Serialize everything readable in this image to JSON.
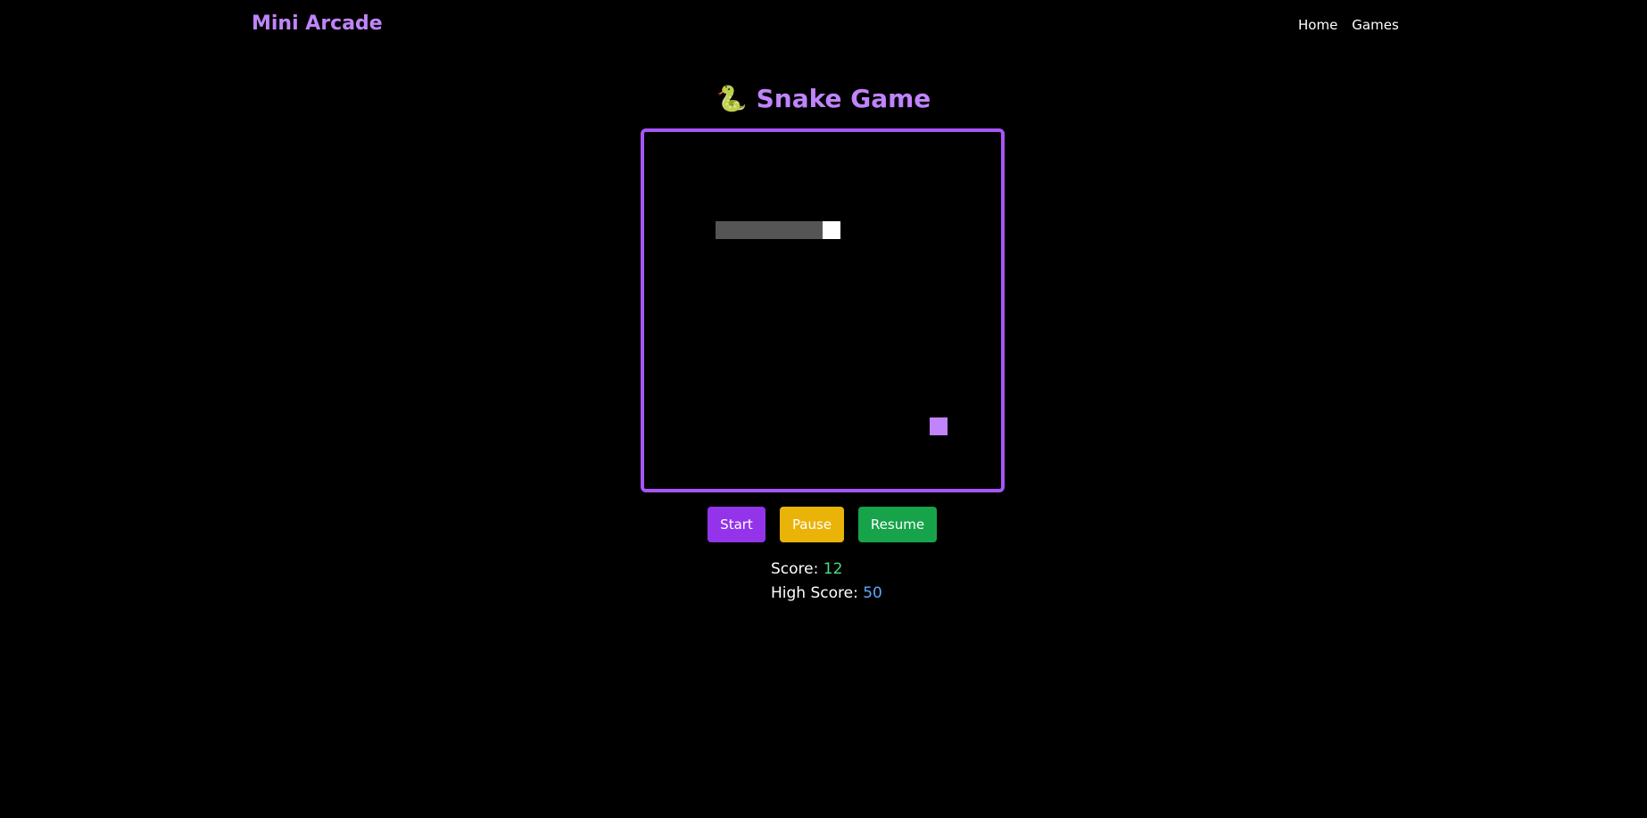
{
  "header": {
    "brand": "Mini Arcade",
    "nav": [
      {
        "label": "Home"
      },
      {
        "label": "Games"
      }
    ]
  },
  "game": {
    "icon": "snake-icon",
    "title": "Snake Game",
    "grid_size": [
      20,
      20
    ],
    "snake": [
      [
        4,
        5
      ],
      [
        5,
        5
      ],
      [
        6,
        5
      ],
      [
        7,
        5
      ],
      [
        8,
        5
      ],
      [
        9,
        5
      ],
      [
        10,
        5
      ]
    ],
    "food": [
      16,
      16
    ],
    "colors": {
      "border": "#a855f7",
      "snake_body": "#555555",
      "snake_head": "#ffffff",
      "food": "#c084fc"
    }
  },
  "controls": {
    "start": "Start",
    "pause": "Pause",
    "resume": "Resume"
  },
  "stats": {
    "score_label": "Score:",
    "score": "12",
    "high_score_label": "High Score:",
    "high_score": "50"
  }
}
